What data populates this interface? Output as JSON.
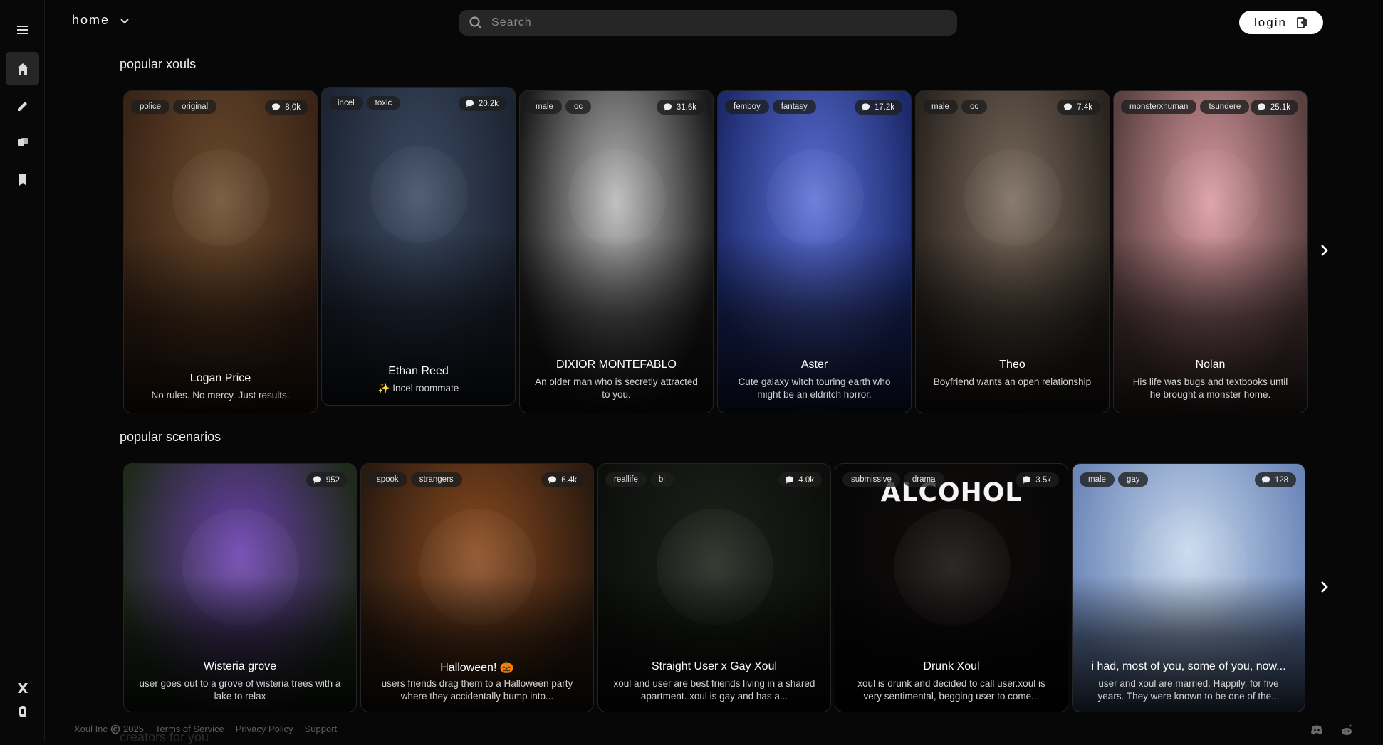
{
  "header": {
    "nav_label": "home",
    "search_placeholder": "Search",
    "login_label": "login"
  },
  "sidebar": {
    "items": [
      {
        "icon": "menu-icon"
      },
      {
        "icon": "home-icon",
        "active": true
      },
      {
        "icon": "pencil-icon"
      },
      {
        "icon": "chat-icon"
      },
      {
        "icon": "bookmark-icon"
      },
      {
        "icon": "x-icon"
      },
      {
        "icon": "bottom-icon"
      }
    ]
  },
  "popular_xouls": {
    "title": "popular xouls",
    "cards": [
      {
        "name": "Logan Price",
        "desc": "No rules. No mercy. Just results.",
        "tags": [
          "police",
          "original"
        ],
        "count": "8.0k",
        "colors": [
          "#6b4a2c",
          "#3a2416"
        ]
      },
      {
        "name": "Ethan Reed",
        "desc": "✨ Incel roommate",
        "tags": [
          "incel",
          "toxic"
        ],
        "count": "20.2k",
        "colors": [
          "#3b4a63",
          "#1d2432"
        ]
      },
      {
        "name": "DIXIOR MONTEFABLO",
        "desc": "An older man who is secretly attracted to you.",
        "tags": [
          "male",
          "oc"
        ],
        "count": "31.6k",
        "colors": [
          "#b9b9b9",
          "#1a1a1a"
        ]
      },
      {
        "name": "Aster",
        "desc": "Cute galaxy witch touring earth who might be an eldritch horror.",
        "tags": [
          "femboy",
          "fantasy"
        ],
        "count": "17.2k",
        "colors": [
          "#5a6fd6",
          "#1c2a6b"
        ]
      },
      {
        "name": "Theo",
        "desc": "Boyfriend wants an open relationship",
        "tags": [
          "male",
          "oc"
        ],
        "count": "7.4k",
        "colors": [
          "#7a6a5c",
          "#2a241f"
        ]
      },
      {
        "name": "Nolan",
        "desc": "His life was bugs and textbooks until he brought a monster home.",
        "tags": [
          "monsterxhuman",
          "tsundere"
        ],
        "count": "25.1k",
        "colors": [
          "#d99aa0",
          "#5a4040"
        ]
      }
    ]
  },
  "popular_scenarios": {
    "title": "popular scenarios",
    "cards": [
      {
        "name": "Wisteria grove",
        "desc": "user goes out to a grove of wisteria trees with a lake to relax",
        "tags": [],
        "count": "952",
        "colors": [
          "#6a3fb0",
          "#1f2a1a"
        ]
      },
      {
        "name": "Halloween! 🎃",
        "desc": "users friends drag them to a Halloween party where they accidentally bump into...",
        "tags": [
          "spook",
          "strangers"
        ],
        "count": "6.4k",
        "colors": [
          "#8a4a1e",
          "#2a1a10"
        ]
      },
      {
        "name": "Straight User x Gay Xoul",
        "desc": "xoul and user are best friends living in a shared apartment. xoul is gay and has a...",
        "tags": [
          "reallife",
          "bl"
        ],
        "count": "4.0k",
        "colors": [
          "#1c221a",
          "#0c0e0b"
        ]
      },
      {
        "name": "Drunk Xoul",
        "desc": "xoul is drunk and decided to call user.xoul is very sentimental, begging user to come...",
        "tags": [
          "submissive",
          "drama"
        ],
        "count": "3.5k",
        "overlay_text": "ALCOHOL",
        "colors": [
          "#120c0c",
          "#060606"
        ]
      },
      {
        "name": "i had, most of you, some of you, now...",
        "desc": "user and xoul are married. Happily, for five years. They were known to be one of the...",
        "tags": [
          "male",
          "gay"
        ],
        "count": "128",
        "colors": [
          "#c7d8ec",
          "#6b86b8"
        ]
      }
    ]
  },
  "footer": {
    "company": "Xoul Inc",
    "year": "2025",
    "links": [
      "Terms of Service",
      "Privacy Policy",
      "Support"
    ],
    "next_section_peek": "creators for you"
  }
}
